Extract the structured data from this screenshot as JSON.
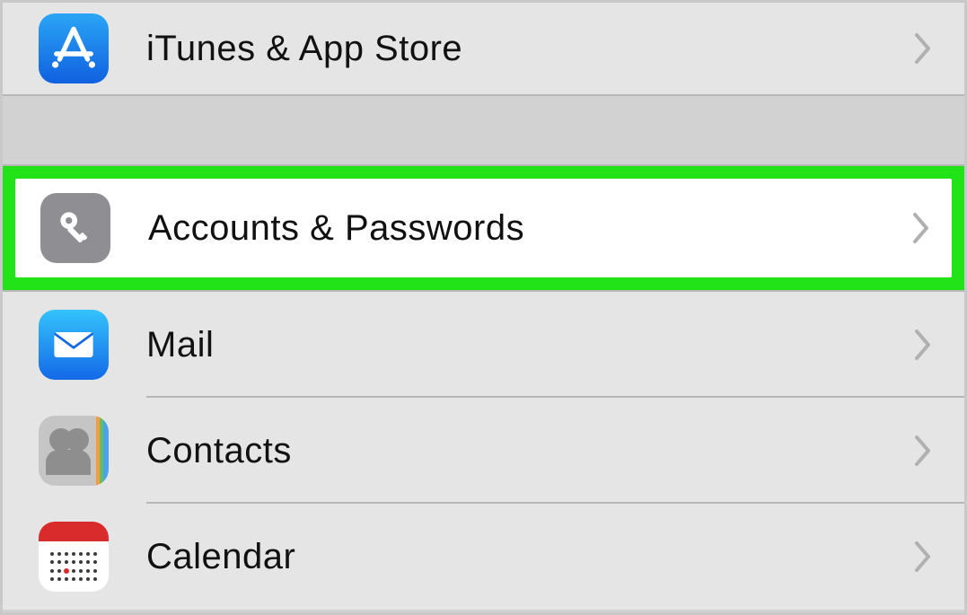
{
  "rows": {
    "itunes": {
      "label": "iTunes & App Store"
    },
    "accounts": {
      "label": "Accounts & Passwords"
    },
    "mail": {
      "label": "Mail"
    },
    "contacts": {
      "label": "Contacts"
    },
    "calendar": {
      "label": "Calendar"
    }
  }
}
